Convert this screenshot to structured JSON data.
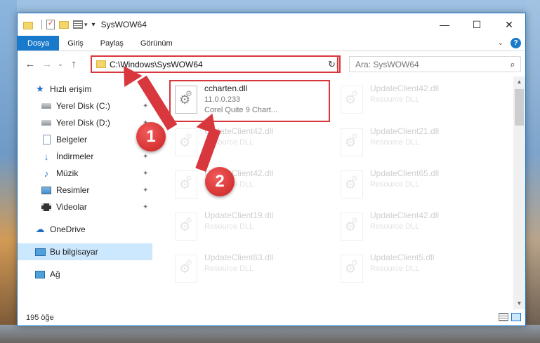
{
  "window": {
    "title": "SysWOW64",
    "minimize_glyph": "—",
    "maximize_glyph": "☐",
    "close_glyph": "✕"
  },
  "ribbon": {
    "tabs": [
      "Dosya",
      "Giriş",
      "Paylaş",
      "Görünüm"
    ]
  },
  "nav": {
    "back_glyph": "←",
    "forward_glyph": "→",
    "recent_glyph": "⌄",
    "up_glyph": "↑",
    "address": "C:\\Windows\\SysWOW64",
    "refresh_glyph": "↻",
    "search_placeholder": "Ara: SysWOW64",
    "search_icon_glyph": "⌕"
  },
  "sidebar": {
    "items": [
      {
        "label": "Hızlı erişim",
        "icon": "star-icon"
      },
      {
        "label": "Yerel Disk (C:)",
        "icon": "drive-icon",
        "pinned": true
      },
      {
        "label": "Yerel Disk (D:)",
        "icon": "drive-icon",
        "pinned": true
      },
      {
        "label": "Belgeler",
        "icon": "documents-icon",
        "pinned": true
      },
      {
        "label": "İndirmeler",
        "icon": "download-icon",
        "pinned": true
      },
      {
        "label": "Müzik",
        "icon": "music-icon",
        "pinned": true
      },
      {
        "label": "Resimler",
        "icon": "pictures-icon",
        "pinned": true
      },
      {
        "label": "Videolar",
        "icon": "videos-icon",
        "pinned": true
      },
      {
        "label": "OneDrive",
        "icon": "cloud-icon"
      },
      {
        "label": "Bu bilgisayar",
        "icon": "computer-icon",
        "selected": true
      },
      {
        "label": "Ağ",
        "icon": "network-icon"
      }
    ],
    "pin_glyph": "📌"
  },
  "files": [
    {
      "name": "ccharten.dll",
      "line2": "11.0.0.233",
      "line3": "Corel Quite 9 Chart...",
      "highlighted": true
    },
    {
      "name": "UpdateClient42.dll",
      "line2": "Resource DLL"
    },
    {
      "name": "UpdateClient42.dll",
      "line2": "Resource DLL"
    },
    {
      "name": "UpdateClient21.dll",
      "line2": "Resource DLL"
    },
    {
      "name": "UpdateClient42.dll",
      "line2": "Resource DLL"
    },
    {
      "name": "UpdateClient65.dll",
      "line2": "Resource DLL"
    },
    {
      "name": "UpdateClient19.dll",
      "line2": "Resource DLL"
    },
    {
      "name": "UpdateClient42.dll",
      "line2": "Resource DLL"
    },
    {
      "name": "UpdateClient63.dll",
      "line2": "Resource DLL"
    },
    {
      "name": "UpdateClient5.dll",
      "line2": "Resource DLL"
    }
  ],
  "status": {
    "count": "195 öğe"
  },
  "callouts": {
    "one": "1",
    "two": "2"
  },
  "colors": {
    "accent": "#1979ca",
    "highlight": "#d8383d",
    "selected": "#cce8ff"
  }
}
